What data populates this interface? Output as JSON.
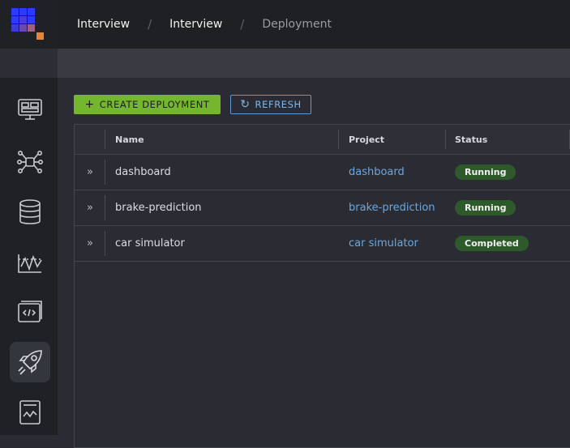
{
  "breadcrumb": [
    "Interview",
    "Interview",
    "Deployment"
  ],
  "toolbar": {
    "create_label": "CREATE DEPLOYMENT",
    "create_icon": "+",
    "refresh_label": "REFRESH",
    "refresh_icon": "↻"
  },
  "table": {
    "columns": [
      "Name",
      "Project",
      "Status"
    ],
    "rows": [
      {
        "name": "dashboard",
        "project": "dashboard",
        "status": "Running"
      },
      {
        "name": "brake-prediction",
        "project": "brake-prediction",
        "status": "Running"
      },
      {
        "name": "car simulator",
        "project": "car simulator",
        "status": "Completed"
      }
    ],
    "expand_glyph": "»"
  },
  "sidebar": {
    "items": [
      "dashboard-icon",
      "pipelines-icon",
      "datasets-icon",
      "monitoring-icon",
      "code-icon",
      "deployment-icon",
      "reports-icon"
    ],
    "active": "deployment-icon"
  },
  "colors": {
    "accent_green": "#74b72e",
    "link_blue": "#6aa7e0",
    "badge_green": "#2e5a2b"
  }
}
